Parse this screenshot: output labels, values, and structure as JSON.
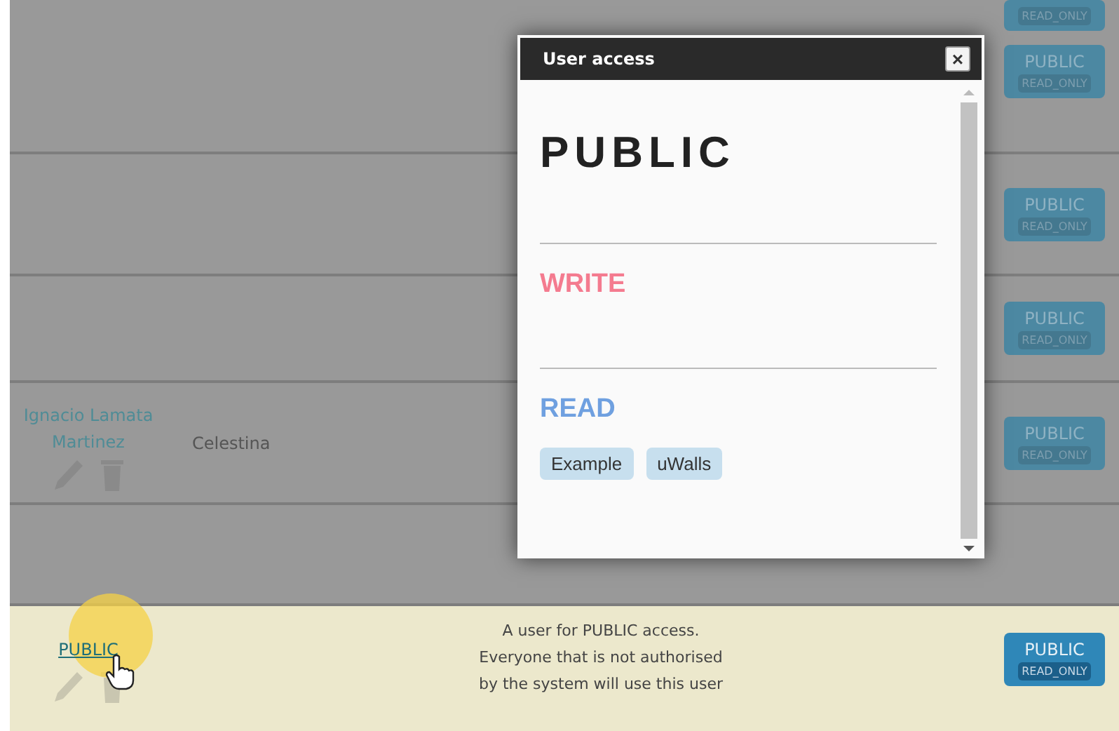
{
  "rows": [
    {
      "access": [
        {
          "badge": "READ_ONLY"
        },
        {
          "label": "PUBLIC",
          "badge": "READ_ONLY"
        }
      ]
    },
    {
      "access": [
        {
          "label": "PUBLIC",
          "badge": "READ_ONLY"
        }
      ]
    },
    {
      "access": [
        {
          "label": "PUBLIC",
          "badge": "READ_ONLY"
        }
      ]
    },
    {
      "name": "Ignacio Lamata Martinez",
      "user": "Celestina",
      "access": [
        {
          "label": "PUBLIC",
          "badge": "READ_ONLY"
        }
      ]
    },
    {
      "access": []
    }
  ],
  "highlighted_row": {
    "name": "PUBLIC",
    "description": "A user for PUBLIC access. Everyone that is not authorised by the system will use this user",
    "access": [
      {
        "label": "PUBLIC",
        "badge": "READ_ONLY"
      }
    ]
  },
  "dialog": {
    "title": "User access",
    "close": "×",
    "user": "PUBLIC",
    "sections": [
      {
        "kind": "write",
        "title": "WRITE"
      },
      {
        "kind": "read",
        "title": "READ",
        "tags": [
          "Example",
          "uWalls"
        ]
      }
    ]
  }
}
